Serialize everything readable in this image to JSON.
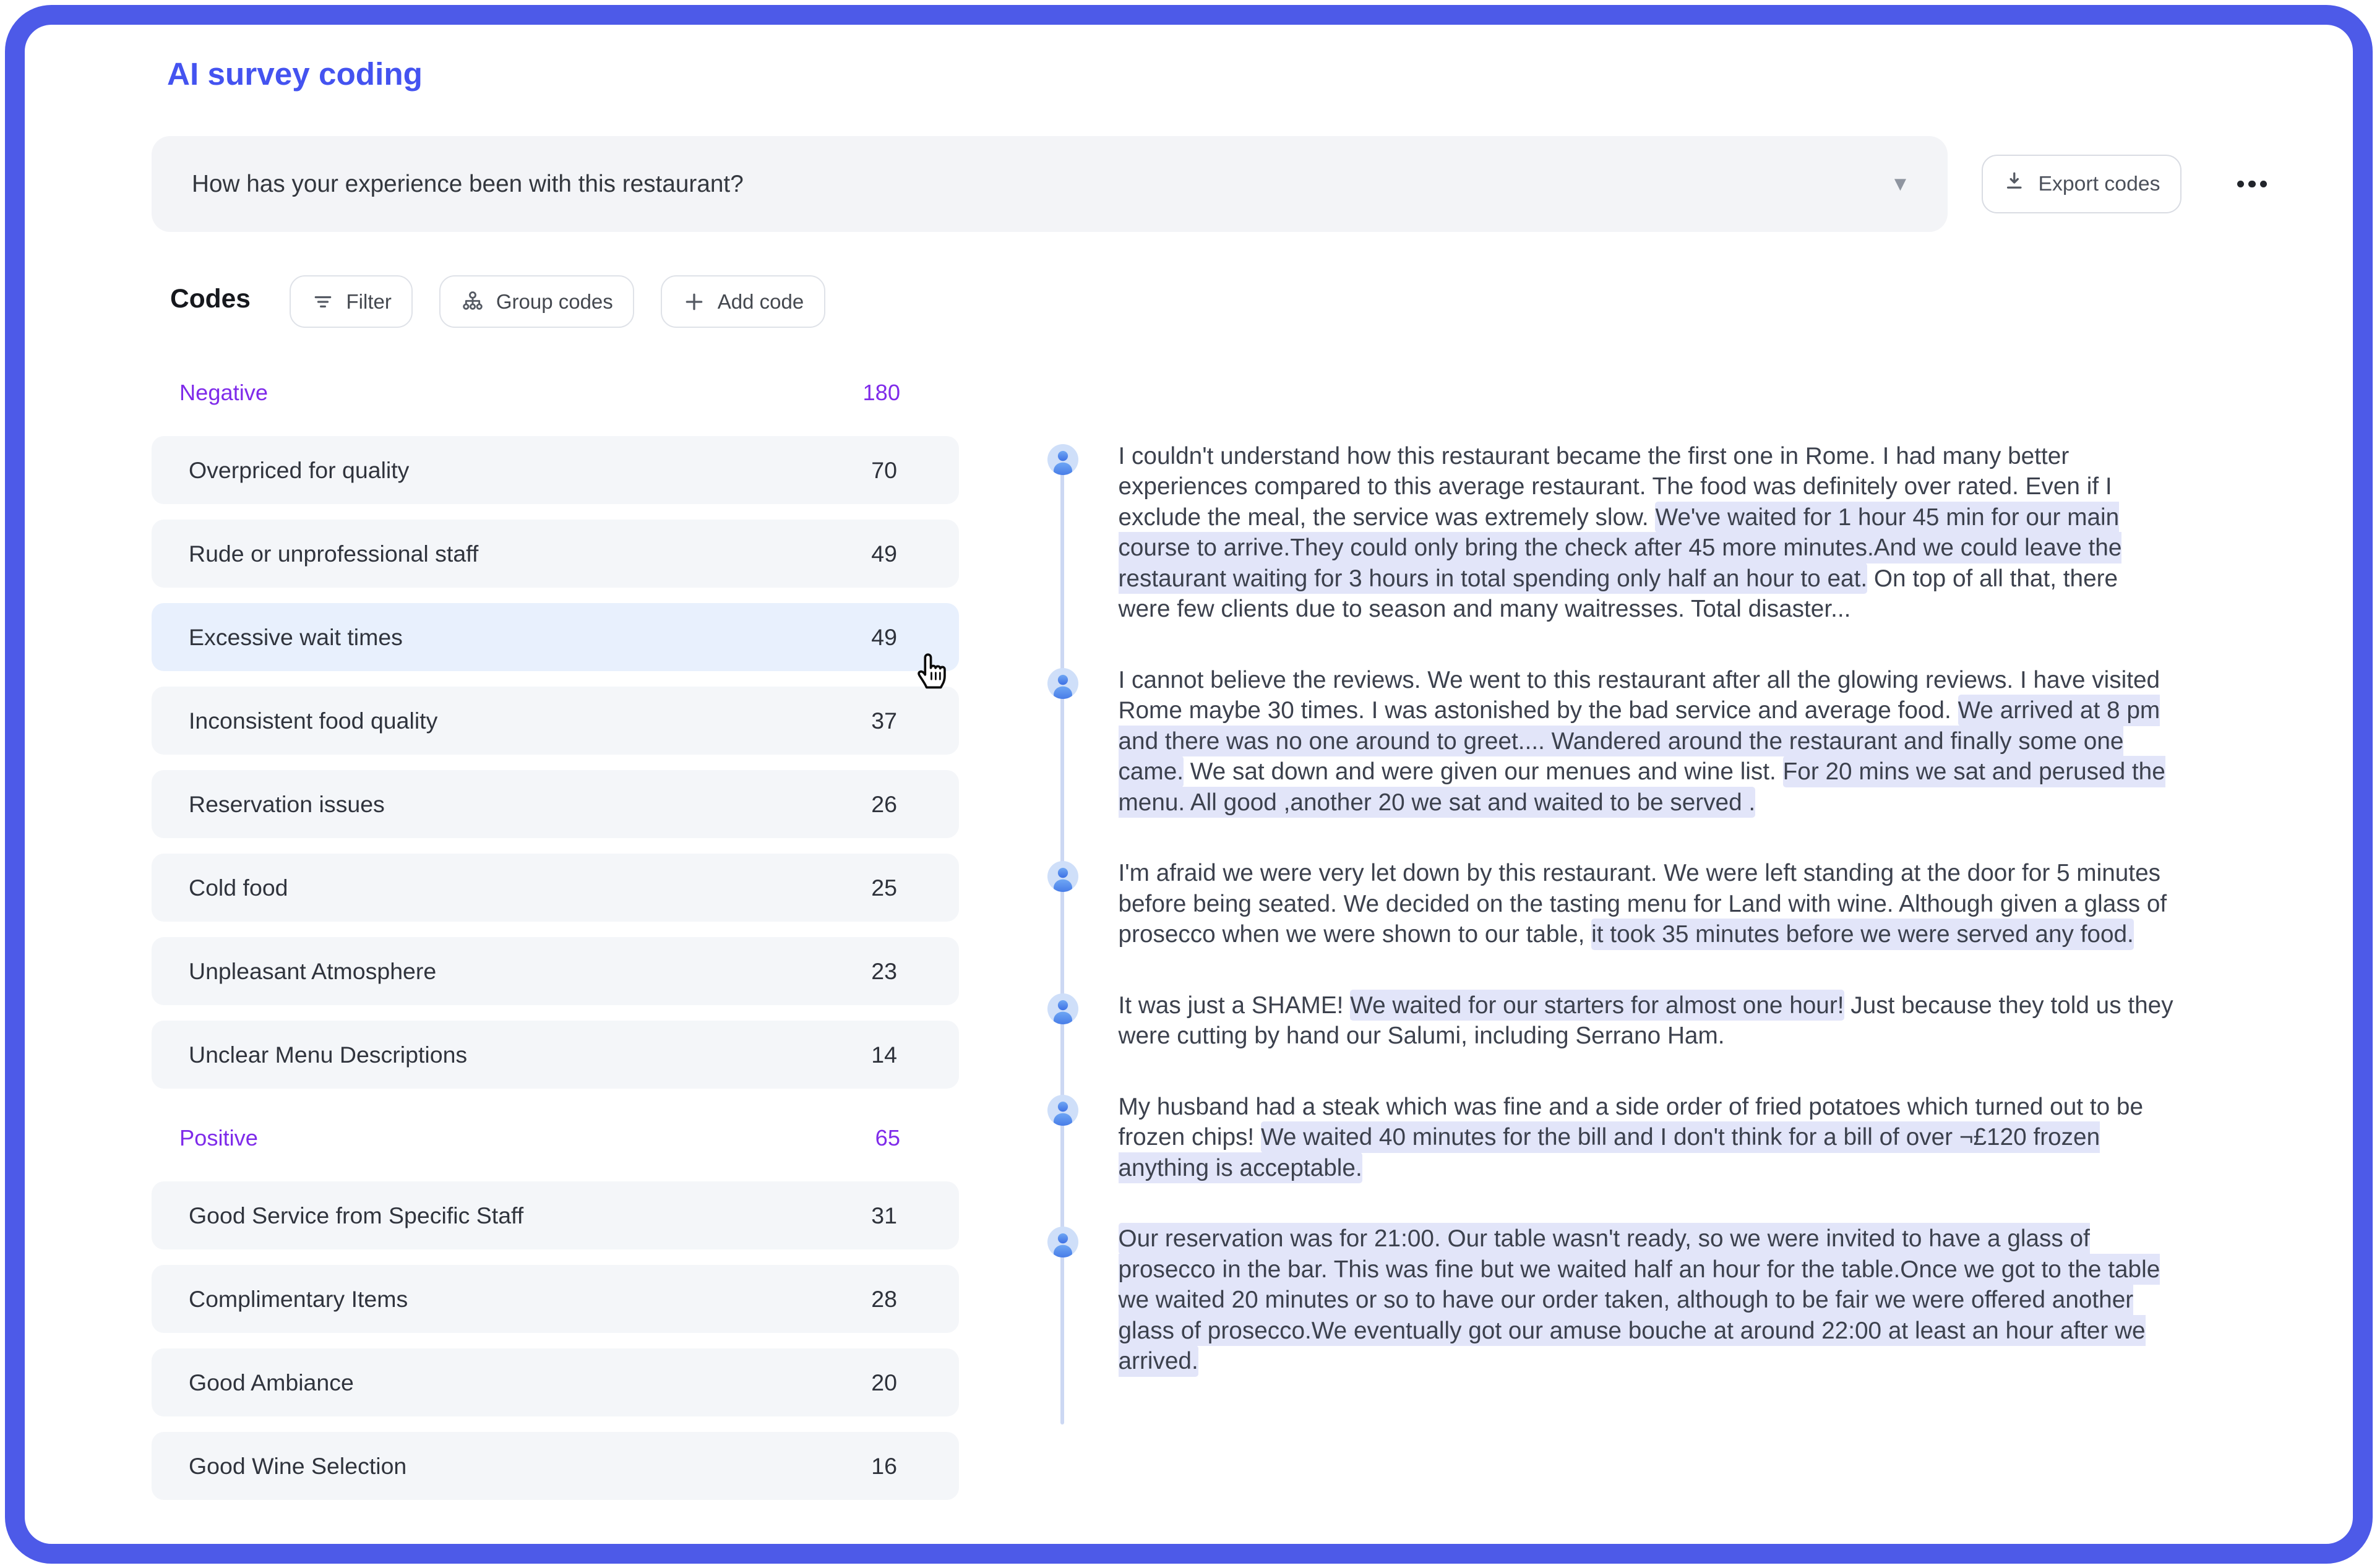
{
  "page_title": "AI survey coding",
  "question_bar": {
    "question": "How has your experience been with this restaurant?",
    "dropdown_icon": "caret-down-icon",
    "export_label": "Export codes",
    "export_icon": "download-icon",
    "more_icon": "more-options-ellipsis-icon"
  },
  "codes_toolbar": {
    "heading": "Codes",
    "filter_label": "Filter",
    "filter_icon": "filter-lines-icon",
    "group_label": "Group codes",
    "group_icon": "hierarchy-icon",
    "add_label": "Add code",
    "add_icon": "plus-icon"
  },
  "code_sections": [
    {
      "name": "Negative",
      "count": "180",
      "items": [
        {
          "label": "Overpriced for quality",
          "count": "70"
        },
        {
          "label": "Rude or unprofessional staff",
          "count": "49"
        },
        {
          "label": "Excessive wait times",
          "count": "49",
          "hovered": true
        },
        {
          "label": "Inconsistent food quality",
          "count": "37"
        },
        {
          "label": "Reservation issues",
          "count": "26"
        },
        {
          "label": "Cold food",
          "count": "25"
        },
        {
          "label": "Unpleasant Atmosphere",
          "count": "23"
        },
        {
          "label": "Unclear Menu Descriptions",
          "count": "14"
        }
      ]
    },
    {
      "name": "Positive",
      "count": "65",
      "items": [
        {
          "label": "Good Service from Specific Staff",
          "count": "31"
        },
        {
          "label": "Complimentary Items",
          "count": "28"
        },
        {
          "label": "Good Ambiance",
          "count": "20"
        },
        {
          "label": "Good Wine Selection",
          "count": "16"
        }
      ]
    }
  ],
  "responses": [
    {
      "segments": [
        {
          "text": "I couldn't understand how this restaurant became the first one in Rome. I had many better experiences compared to this average restaurant. The food was definitely over rated. Even if I exclude the meal, the service was extremely slow. ",
          "highlight": false
        },
        {
          "text": "We've waited for 1 hour 45 min for our main course to arrive.They could only bring the check after 45 more minutes.And we could leave the restaurant waiting for 3 hours in total spending only half an hour to eat.",
          "highlight": true
        },
        {
          "text": " On top of all that, there were few clients due to season and many waitresses. Total disaster...",
          "highlight": false
        }
      ]
    },
    {
      "segments": [
        {
          "text": "I cannot believe the reviews. We went to this restaurant after all the glowing reviews. I have visited Rome maybe 30 times. I was astonished by the bad service and average food. ",
          "highlight": false
        },
        {
          "text": "We arrived at 8 pm and there was no one around to greet.... Wandered around the restaurant and finally some one came.",
          "highlight": true
        },
        {
          "text": " We sat down and were given our menues and wine list. ",
          "highlight": false
        },
        {
          "text": "For 20 mins we sat and perused the menu. All good ,another 20 we sat and waited to be served .",
          "highlight": true
        }
      ]
    },
    {
      "segments": [
        {
          "text": "I'm afraid we were very let down by this restaurant. We were left standing at the door for 5 minutes before being seated. We decided on the tasting menu for Land with wine. Although given a glass of prosecco when we were shown to our table, ",
          "highlight": false
        },
        {
          "text": "it took 35 minutes before we were served any food.",
          "highlight": true
        }
      ]
    },
    {
      "segments": [
        {
          "text": "It was just a SHAME! ",
          "highlight": false
        },
        {
          "text": "We waited for our starters for almost one hour!",
          "highlight": true
        },
        {
          "text": " Just because they told us they were cutting by hand our Salumi, including Serrano Ham.",
          "highlight": false
        }
      ]
    },
    {
      "segments": [
        {
          "text": "My husband had a steak which was fine and a side order of fried potatoes which turned out to be frozen chips! ",
          "highlight": false
        },
        {
          "text": "We waited 40 minutes for the bill and I don't think for a bill of over ¬£120 frozen anything is acceptable.",
          "highlight": true
        }
      ]
    },
    {
      "segments": [
        {
          "text": "Our reservation was for 21:00. Our table wasn't ready, so we were invited to have a glass of prosecco in the bar. This was fine but we waited half an hour for the table.Once we got to the table we waited 20 minutes or so to have our order taken, although to be fair we were offered another glass of prosecco.We eventually got our amuse bouche at around 22:00 at least an hour after we arrived.",
          "highlight": true
        }
      ]
    }
  ],
  "colors": {
    "frame_border": "#4d5ae8",
    "title_accent": "#4453f0",
    "section_purple": "#7f2bea",
    "row_bg": "#f4f6f9",
    "row_hover_bg": "#e8f0fd",
    "text_highlight": "#e2e5f9",
    "avatar_bg": "#cfdff9",
    "avatar_person": "#4d86ec"
  }
}
